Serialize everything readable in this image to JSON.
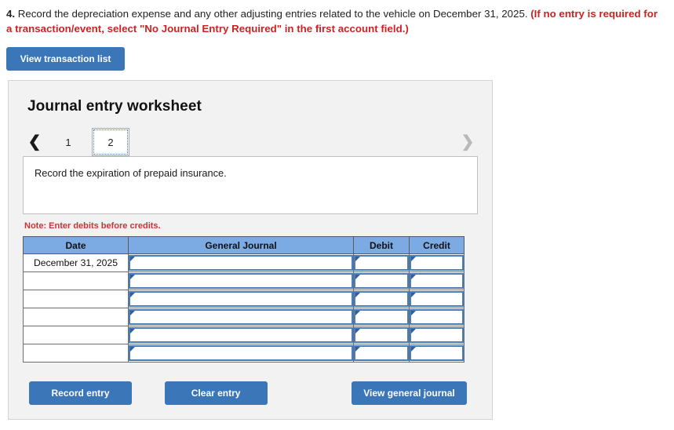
{
  "question": {
    "number": "4.",
    "text_main": " Record the depreciation expense and any other adjusting entries related to the vehicle on December 31, 2025. ",
    "text_red": "(If no entry is required for a transaction/event, select \"No Journal Entry Required\" in the first account field.)"
  },
  "toolbar": {
    "view_transaction_list_label": "View transaction list"
  },
  "worksheet": {
    "title": "Journal entry worksheet",
    "prev_icon": "chevron-left-icon",
    "next_icon": "chevron-right-icon",
    "tabs": [
      {
        "label": "1",
        "active": false
      },
      {
        "label": "2",
        "active": true
      }
    ],
    "prompt": "Record the expiration of prepaid insurance.",
    "note": "Note: Enter debits before credits.",
    "table": {
      "headers": [
        "Date",
        "General Journal",
        "Debit",
        "Credit"
      ],
      "rows": [
        {
          "date": "December 31, 2025",
          "general_journal": "",
          "debit": "",
          "credit": ""
        },
        {
          "date": "",
          "general_journal": "",
          "debit": "",
          "credit": ""
        },
        {
          "date": "",
          "general_journal": "",
          "debit": "",
          "credit": ""
        },
        {
          "date": "",
          "general_journal": "",
          "debit": "",
          "credit": ""
        },
        {
          "date": "",
          "general_journal": "",
          "debit": "",
          "credit": ""
        },
        {
          "date": "",
          "general_journal": "",
          "debit": "",
          "credit": ""
        }
      ]
    },
    "actions": {
      "record_entry_label": "Record entry",
      "clear_entry_label": "Clear entry",
      "view_general_journal_label": "View general journal"
    }
  },
  "colors": {
    "button_blue": "#3a76b8",
    "header_blue": "#7babe2",
    "field_border_blue": "#4a7ebb",
    "marker_blue": "#2f5f9e",
    "red": "#cc2222",
    "note_red": "#cc3333",
    "card_bg": "#f2f2f2"
  }
}
